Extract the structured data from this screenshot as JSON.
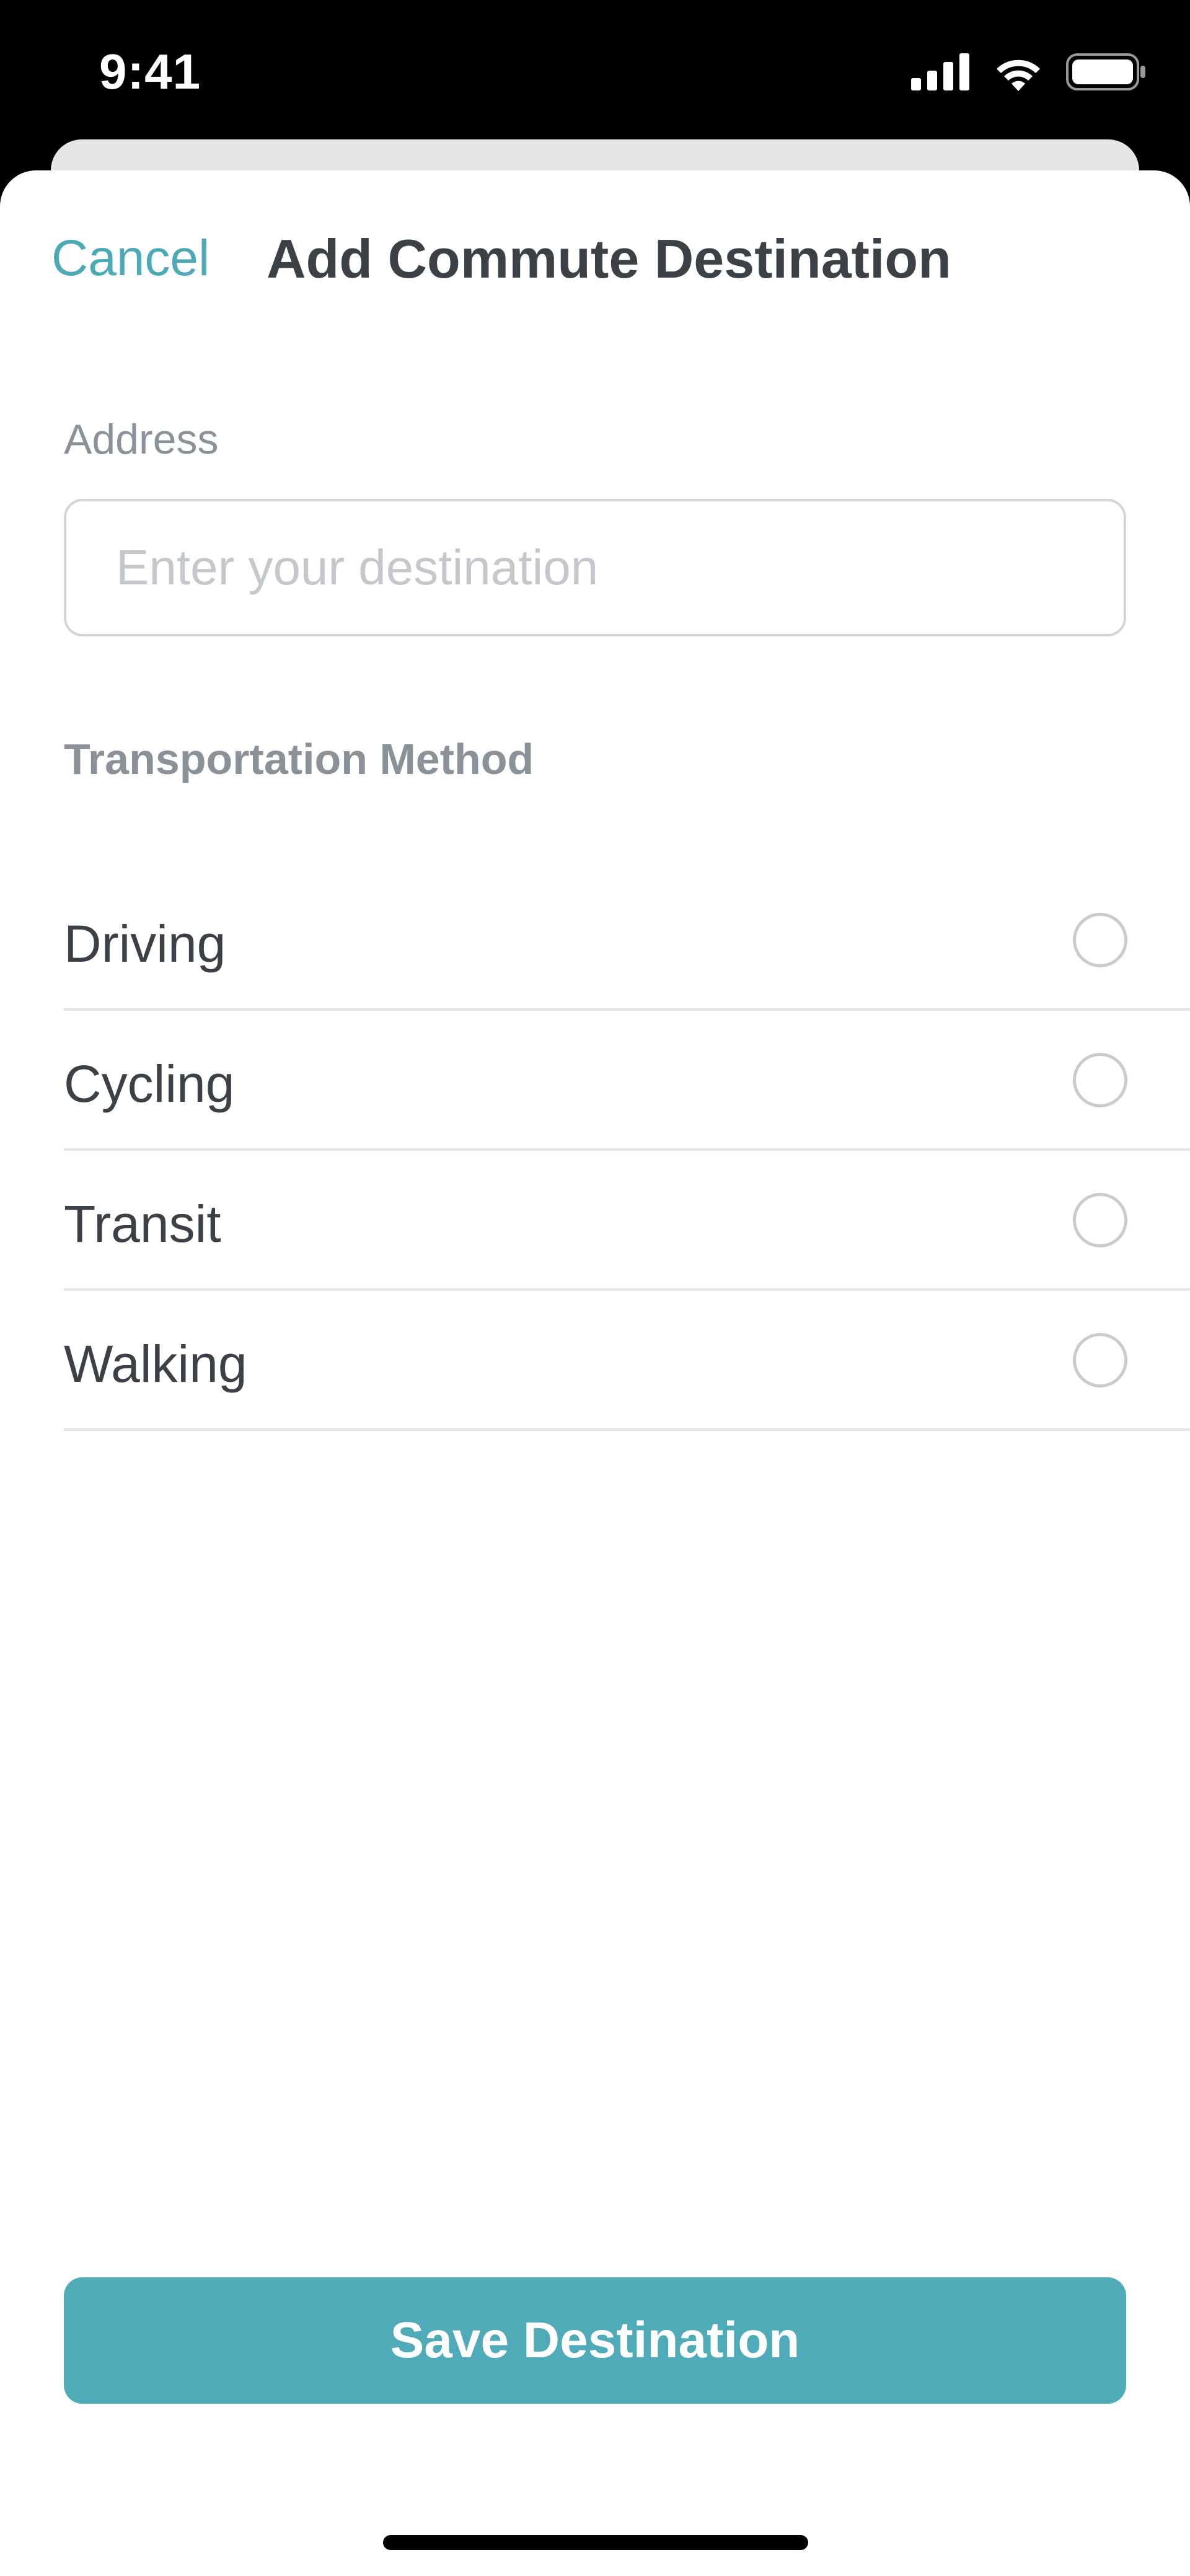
{
  "status_bar": {
    "time": "9:41",
    "icons": [
      "signal-icon",
      "wifi-icon",
      "battery-icon"
    ]
  },
  "header": {
    "cancel_label": "Cancel",
    "title": "Add Commute Destination"
  },
  "address": {
    "label": "Address",
    "value": "",
    "placeholder": "Enter your destination"
  },
  "transport": {
    "title": "Transportation Method",
    "options": [
      {
        "label": "Driving",
        "selected": false
      },
      {
        "label": "Cycling",
        "selected": false
      },
      {
        "label": "Transit",
        "selected": false
      },
      {
        "label": "Walking",
        "selected": false
      }
    ]
  },
  "save_label": "Save Destination",
  "colors": {
    "accent": "#4eabb7",
    "text": "#3c4147",
    "secondary_text": "#8a9199",
    "divider": "#e3e4e6"
  }
}
